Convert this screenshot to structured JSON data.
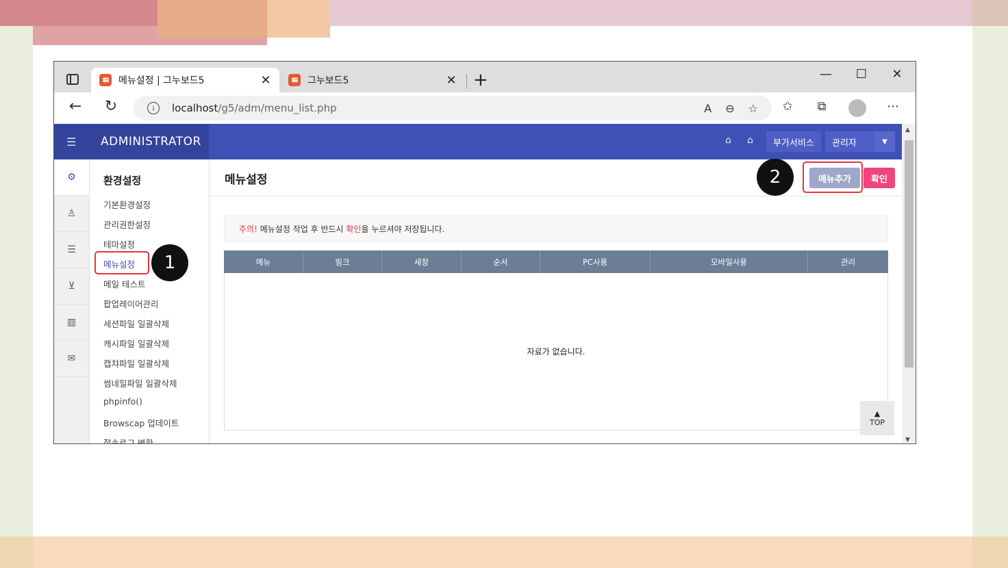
{
  "browser": {
    "tabs": [
      {
        "title": "메뉴설정 | 그누보드5",
        "favicon": "gnuboard-favicon",
        "active": true
      },
      {
        "title": "그누보드5",
        "favicon": "gnuboard-favicon",
        "active": false
      }
    ],
    "url_host": "localhost",
    "url_path": "/g5/adm/menu_list.php"
  },
  "admin": {
    "brand": "ADMINISTRATOR",
    "header_buttons": {
      "services": "부가서비스",
      "admin": "관리자"
    },
    "section_title": "환경설정",
    "menu_items": [
      "기본환경설정",
      "관리권한설정",
      "테마설정",
      "메뉴설정",
      "메일 테스트",
      "팝업레이어관리",
      "세션파일 일괄삭제",
      "캐시파일 일괄삭제",
      "캡챠파일 일괄삭제",
      "썸네일파일 일괄삭제",
      "phpinfo()",
      "Browscap 업데이트",
      "접속로그 변환"
    ],
    "current_menu": "메뉴설정"
  },
  "content": {
    "title": "메뉴설정",
    "add_button": "메뉴추가",
    "ok_button": "확인",
    "notice": {
      "prefix": "주의!",
      "middle": " 메뉴설정 작업 후 반드시 ",
      "highlight": "확인",
      "suffix": "을 누르셔야 저장됩니다."
    },
    "table_headers": [
      "메뉴",
      "링크",
      "새창",
      "순서",
      "PC사용",
      "모바일사용",
      "관리"
    ],
    "empty_text": "자료가 없습니다.",
    "top_button": "TOP"
  },
  "annotations": {
    "step1": "1",
    "step2": "2"
  },
  "colors": {
    "header": "#3f51b5",
    "accent_pink": "#f0457c",
    "highlight_red": "#e8323c",
    "table_head": "#6c7d96"
  }
}
